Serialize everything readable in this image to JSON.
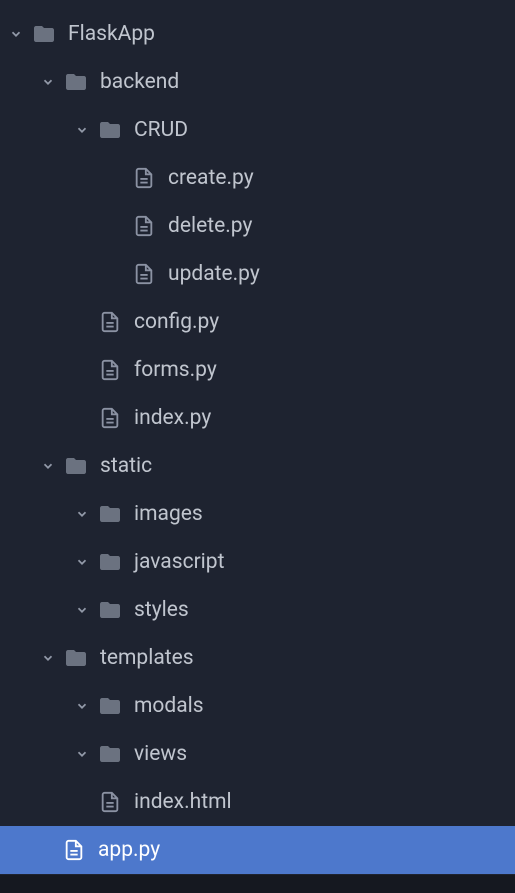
{
  "tree": {
    "root": {
      "name": "FlaskApp",
      "children": {
        "backend": {
          "name": "backend",
          "children": {
            "crud": {
              "name": "CRUD",
              "files": {
                "create": "create.py",
                "delete": "delete.py",
                "update": "update.py"
              }
            }
          },
          "files": {
            "config": "config.py",
            "forms": "forms.py",
            "index": "index.py"
          }
        },
        "static": {
          "name": "static",
          "children": {
            "images": {
              "name": "images"
            },
            "javascript": {
              "name": "javascript"
            },
            "styles": {
              "name": "styles"
            }
          }
        },
        "templates": {
          "name": "templates",
          "children": {
            "modals": {
              "name": "modals"
            },
            "views": {
              "name": "views"
            }
          },
          "files": {
            "index": "index.html"
          }
        }
      },
      "files": {
        "app": "app.py"
      }
    }
  },
  "selected": "app.py"
}
